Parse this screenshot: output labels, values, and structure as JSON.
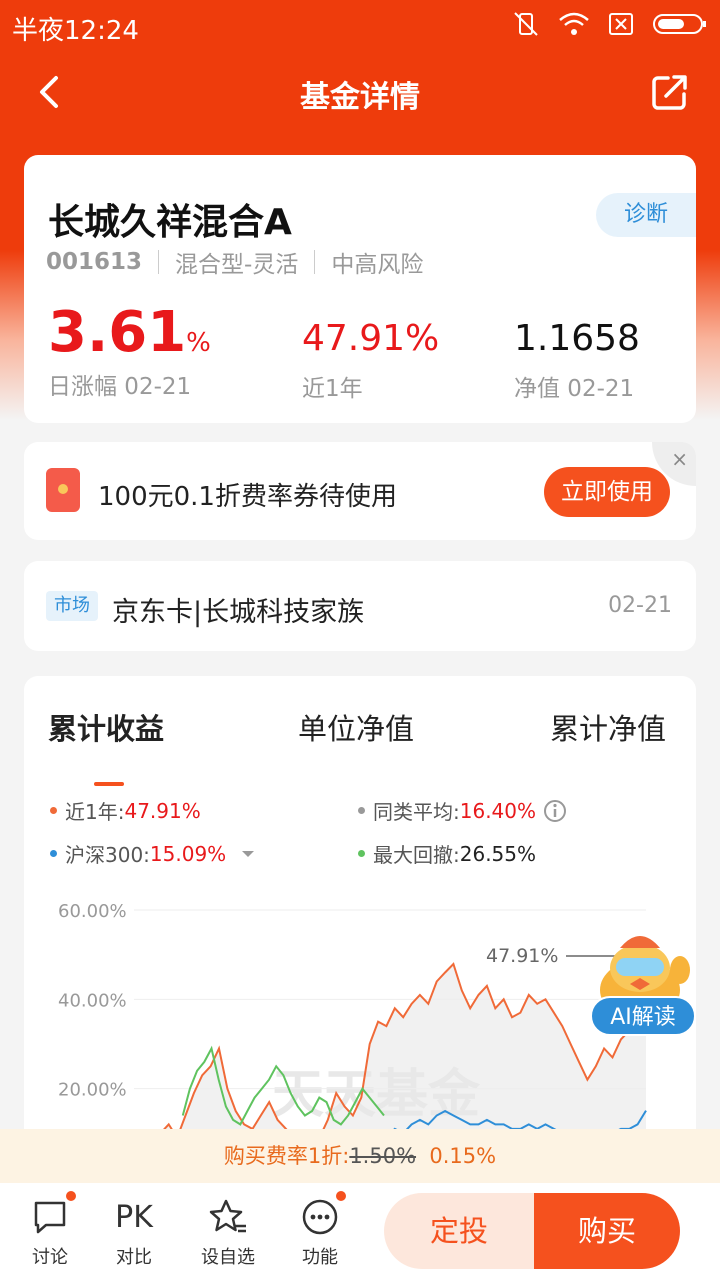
{
  "status_bar": {
    "time": "半夜12:24"
  },
  "header": {
    "title": "基金详情"
  },
  "fund": {
    "name": "长城久祥混合A",
    "diagnose": "诊断",
    "code": "001613",
    "type": "混合型-灵活",
    "risk": "中高风险",
    "daily_change": "3.61",
    "daily_change_unit": "%",
    "daily_change_label": "日涨幅 02-21",
    "year_return": "47.91%",
    "year_return_label": "近1年",
    "nav": "1.1658",
    "nav_label": "净值 02-21"
  },
  "coupon": {
    "text": "100元0.1折费率券待使用",
    "button": "立即使用",
    "close": "×"
  },
  "market": {
    "tag": "市场",
    "text": "京东卡|长城科技家族",
    "date": "02-21"
  },
  "chart_tabs": [
    "累计收益",
    "单位净值",
    "累计净值"
  ],
  "legend": {
    "year": {
      "label": "近1年:",
      "value": "47.91%"
    },
    "category_avg": {
      "label": "同类平均:",
      "value": "16.40%"
    },
    "csi300": {
      "label": "沪深300:",
      "value": "15.09%"
    },
    "max_drawdown": {
      "label": "最大回撤:",
      "value": "26.55%"
    }
  },
  "ai_badge": "AI解读",
  "watermark": "天天基金",
  "fee_bar": {
    "prefix": "购买费率1折:",
    "old": "1.50%",
    "new": "0.15%"
  },
  "bottom_nav": {
    "discuss": "讨论",
    "compare_icon": "PK",
    "compare": "对比",
    "watchlist": "设自选",
    "functions": "功能",
    "regular": "定投",
    "buy": "购买"
  },
  "colors": {
    "brand": "#ee3c0c",
    "up": "#e8191b",
    "fund_line": "#f06a38",
    "csi300_line": "#2e8ed8",
    "drawdown_line": "#5fc35f",
    "avg_line": "#999999"
  },
  "chart_data": {
    "type": "line",
    "y_ticks": [
      "60.00%",
      "40.00%",
      "20.00%"
    ],
    "ylim": [
      0,
      60
    ],
    "peak_label": "47.91%",
    "series": [
      {
        "name": "近1年",
        "values": [
          8,
          10,
          12,
          9,
          14,
          19,
          23,
          25,
          29,
          20,
          15,
          12,
          11,
          14,
          17,
          13,
          11,
          9,
          8,
          10,
          9,
          13,
          19,
          16,
          14,
          18,
          30,
          35,
          34,
          38,
          36,
          39,
          41,
          39,
          44,
          46,
          47.91,
          42,
          38,
          41,
          43,
          38,
          40,
          36,
          37,
          41,
          39,
          40,
          37,
          34,
          30,
          26,
          22,
          25,
          29,
          27,
          31,
          33,
          37,
          39
        ]
      },
      {
        "name": "沪深300",
        "values": [
          4,
          4,
          5,
          5,
          4,
          5,
          6,
          5,
          6,
          5,
          4,
          4,
          5,
          5,
          4,
          4,
          5,
          4,
          3,
          4,
          4,
          5,
          6,
          5,
          5,
          6,
          8,
          10,
          9,
          11,
          10,
          12,
          13,
          12,
          14,
          15,
          14,
          13,
          12,
          12,
          13,
          12,
          12,
          11,
          11,
          12,
          11,
          12,
          11,
          10,
          10,
          9,
          9,
          10,
          10,
          10,
          11,
          11,
          12,
          15.09
        ]
      },
      {
        "name": "最大回撤",
        "values": [
          null,
          null,
          null,
          null,
          14,
          20,
          24,
          26,
          29,
          22,
          16,
          13,
          12,
          15,
          18,
          20,
          22,
          25,
          23,
          19,
          16,
          14,
          15,
          18,
          17,
          13,
          12,
          14,
          17,
          20,
          18,
          16,
          14
        ]
      }
    ]
  }
}
